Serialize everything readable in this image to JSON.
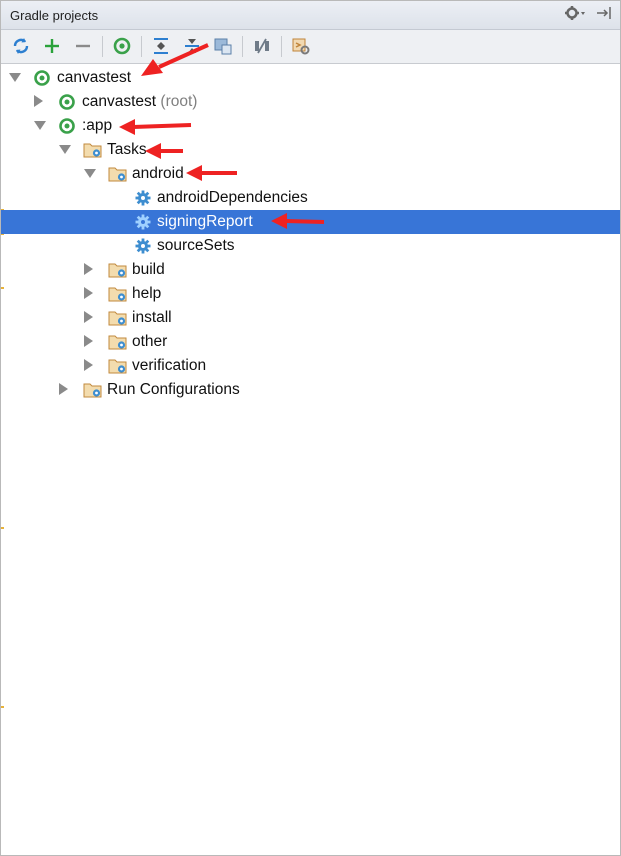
{
  "panel": {
    "title": "Gradle projects"
  },
  "tree": {
    "root": "canvastest",
    "root_child": "canvastest",
    "root_child_suffix": "(root)",
    "app": ":app",
    "tasks": "Tasks",
    "android": "android",
    "android_tasks": [
      "androidDependencies",
      "signingReport",
      "sourceSets"
    ],
    "task_groups": [
      "build",
      "help",
      "install",
      "other",
      "verification"
    ],
    "run_configurations": "Run Configurations"
  },
  "colors": {
    "selection": "#3875d7",
    "gradle_green": "#3aa14a",
    "folder": "#d4a055",
    "gear": "#3e8ed0",
    "annotation_arrow": "#ee2222"
  },
  "selected_task": "signingReport"
}
